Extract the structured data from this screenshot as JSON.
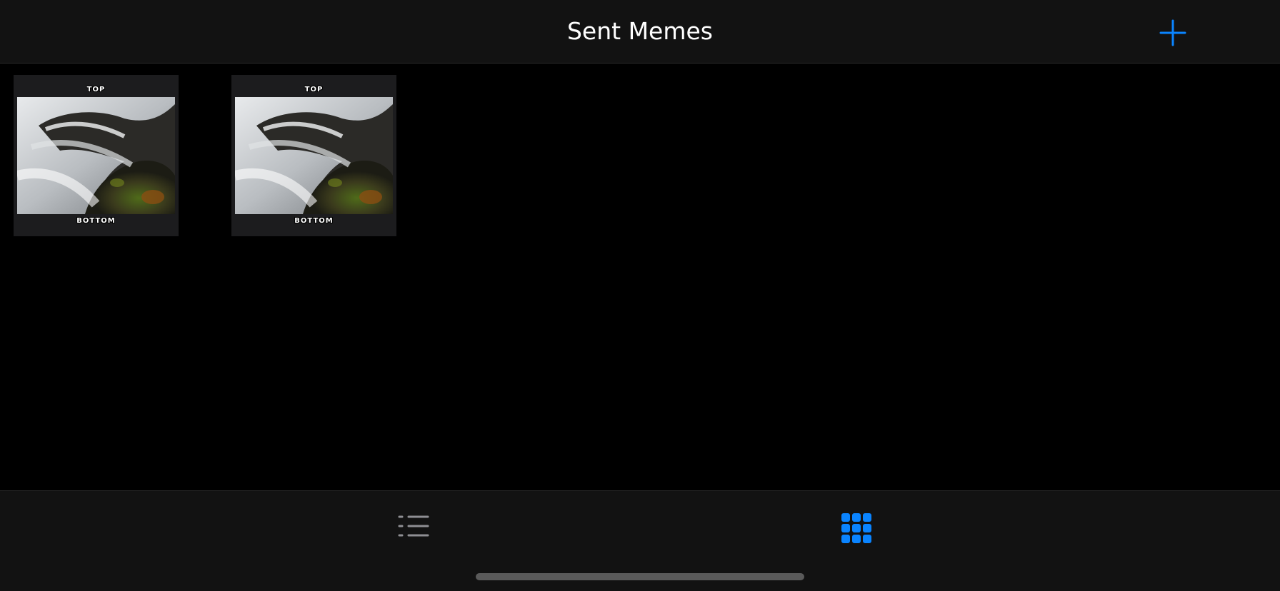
{
  "navbar": {
    "title": "Sent Memes",
    "add_icon": "plus-icon",
    "accent_color": "#0A84FF"
  },
  "memes": [
    {
      "top_text": "TOP",
      "bottom_text": "BOTTOM",
      "image": "waterfall-rocks-photo"
    },
    {
      "top_text": "TOP",
      "bottom_text": "BOTTOM",
      "image": "waterfall-rocks-photo"
    }
  ],
  "tabbar": {
    "tabs": [
      {
        "icon": "list-icon",
        "selected": false
      },
      {
        "icon": "grid-icon",
        "selected": true
      }
    ],
    "selected_color": "#0A84FF",
    "unselected_color": "#8E8E93"
  }
}
